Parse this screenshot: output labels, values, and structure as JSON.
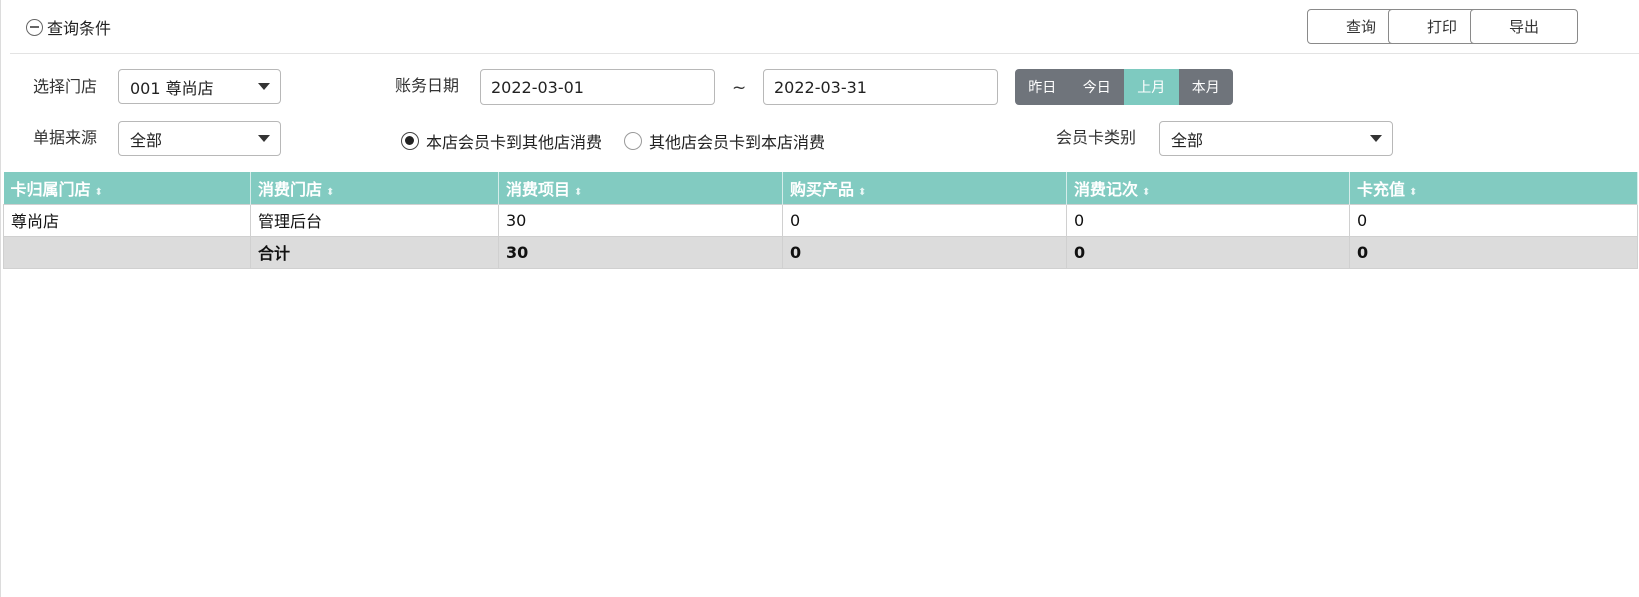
{
  "panel": {
    "title": "查询条件",
    "toggle_icon": "minus-circle-icon"
  },
  "toolbar": {
    "query_label": "查询",
    "print_label": "打印",
    "export_label": "导出"
  },
  "filters": {
    "store": {
      "label": "选择门店",
      "value": "001 尊尚店"
    },
    "account_date": {
      "label": "账务日期",
      "start": "2022-03-01",
      "separator": "~",
      "end": "2022-03-31"
    },
    "date_presets": [
      {
        "label": "昨日",
        "active": false
      },
      {
        "label": "今日",
        "active": false
      },
      {
        "label": "上月",
        "active": true
      },
      {
        "label": "本月",
        "active": false
      }
    ],
    "source": {
      "label": "单据来源",
      "value": "全部"
    },
    "consume_mode": [
      {
        "label": "本店会员卡到其他店消费",
        "checked": true
      },
      {
        "label": "其他店会员卡到本店消费",
        "checked": false
      }
    ],
    "card_type": {
      "label": "会员卡类别",
      "value": "全部"
    }
  },
  "table": {
    "columns": [
      "卡归属门店",
      "消费门店",
      "消费项目",
      "购买产品",
      "消费记次",
      "卡充值"
    ],
    "rows": [
      [
        "尊尚店",
        "管理后台",
        "30",
        "0",
        "0",
        "0"
      ]
    ],
    "total": [
      "",
      "合计",
      "30",
      "0",
      "0",
      "0"
    ]
  },
  "colors": {
    "header": "#82cbc1",
    "active_preset": "#7ecac0",
    "preset": "#6f747b",
    "total_row": "#dcdcdc"
  }
}
